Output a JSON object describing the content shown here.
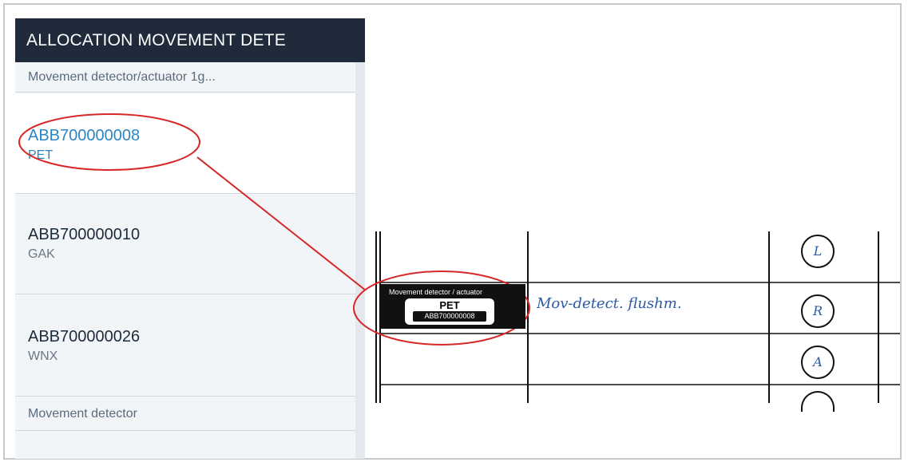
{
  "panel": {
    "header": "ALLOCATION MOVEMENT DETE",
    "section_top": "Movement detector/actuator 1g...",
    "items": [
      {
        "id": "ABB700000008",
        "code": "PET",
        "selected": true
      },
      {
        "id": "ABB700000010",
        "code": "GAK",
        "selected": false
      },
      {
        "id": "ABB700000026",
        "code": "WNX",
        "selected": false
      }
    ],
    "section_bottom": "Movement detector"
  },
  "plan": {
    "label": {
      "title": "Movement detector / actuator",
      "code": "PET",
      "number": "ABB700000008"
    },
    "handwritten": "Mov-detect. flushm.",
    "circles": [
      "L",
      "R",
      "A",
      ""
    ]
  },
  "colors": {
    "header_bg": "#1f2a3a",
    "selected_text": "#2c86c5",
    "annotation": "#d62828"
  }
}
